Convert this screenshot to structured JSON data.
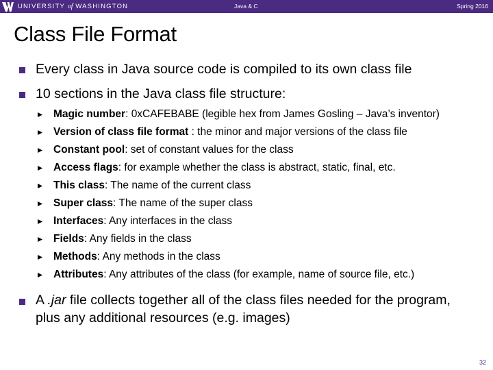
{
  "header": {
    "university_prefix": "UNIVERSITY",
    "university_of": "of",
    "university_suffix": "WASHINGTON",
    "course": "Java & C",
    "term": "Spring 2016"
  },
  "slide": {
    "title": "Class File Format",
    "bullet1": "Every class in Java source code is compiled to its own class file",
    "bullet2": "10 sections in the Java class file structure:",
    "sections": [
      {
        "term": "Magic number",
        "desc": ": 0xCAFEBABE (legible hex from James Gosling – Java’s inventor)"
      },
      {
        "term": "Version of class file format",
        "desc": " : the minor and major versions of the class file"
      },
      {
        "term": "Constant pool",
        "desc": ": set of constant values for the class"
      },
      {
        "term": "Access flags",
        "desc": ": for example whether the class is abstract, static, final, etc."
      },
      {
        "term": "This class",
        "desc": ": The name of the current class"
      },
      {
        "term": "Super class",
        "desc": ": The name of the super class"
      },
      {
        "term": "Interfaces",
        "desc": ": Any interfaces in the class"
      },
      {
        "term": "Fields",
        "desc": ": Any fields in the class"
      },
      {
        "term": "Methods",
        "desc": ": Any methods in the class"
      },
      {
        "term": "Attributes",
        "desc": ": Any attributes of the class (for example, name of source file, etc.)"
      }
    ],
    "bullet3_pre": "A ",
    "bullet3_em": ".jar",
    "bullet3_post": " file collects together all of the class files needed for the program, plus any additional resources (e.g. images)",
    "page_number": "32"
  },
  "colors": {
    "brand_purple": "#4b2a82"
  }
}
